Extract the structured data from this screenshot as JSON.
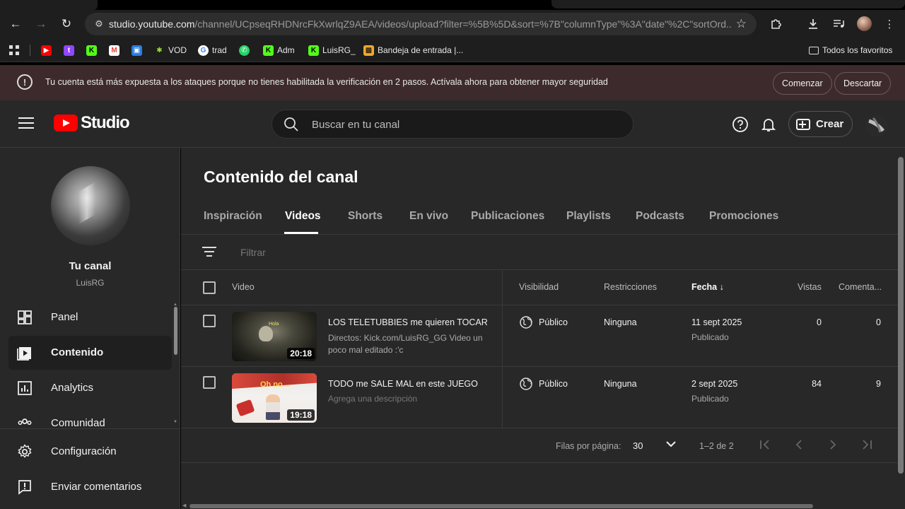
{
  "browser": {
    "url_host": "studio.youtube.com",
    "url_path": "/channel/UCpseqRHDNrcFkXwrlqZ9AEA/videos/upload?filter=%5B%5D&sort=%7B\"columnType\"%3A\"date\"%2C\"sortOrd...",
    "bookmarks": [
      "VOD",
      "trad",
      "Adm",
      "LuisRG_",
      "Bandeja de entrada |..."
    ],
    "all_bookmarks": "Todos los favoritos"
  },
  "banner": {
    "message": "Tu cuenta está más expuesta a los ataques porque no tienes habilitada la verificación en 2 pasos. Actívala ahora para obtener mayor seguridad",
    "start_label": "Comenzar",
    "dismiss_label": "Descartar"
  },
  "header": {
    "logo_text": "Studio",
    "search_placeholder": "Buscar en tu canal",
    "create_label": "Crear"
  },
  "sidebar": {
    "channel_title": "Tu canal",
    "channel_handle": "LuisRG",
    "items": [
      {
        "label": "Panel",
        "icon": "dashboard-icon"
      },
      {
        "label": "Contenido",
        "icon": "content-icon",
        "active": true
      },
      {
        "label": "Analytics",
        "icon": "analytics-icon"
      },
      {
        "label": "Comunidad",
        "icon": "community-icon"
      }
    ],
    "footer_items": [
      {
        "label": "Configuración",
        "icon": "gear-icon"
      },
      {
        "label": "Enviar comentarios",
        "icon": "feedback-icon"
      }
    ]
  },
  "main": {
    "title": "Contenido del canal",
    "tabs": [
      "Inspiración",
      "Videos",
      "Shorts",
      "En vivo",
      "Publicaciones",
      "Playlists",
      "Podcasts",
      "Promociones"
    ],
    "active_tab": "Videos",
    "filter_placeholder": "Filtrar",
    "columns": {
      "video": "Video",
      "visibility": "Visibilidad",
      "restrictions": "Restricciones",
      "date": "Fecha",
      "views": "Vistas",
      "comments": "Comenta..."
    },
    "rows": [
      {
        "title": "LOS TELETUBBIES me quieren TOCAR",
        "description": "Directos: Kick.com/LuisRG_GG Video un poco mal editado :'c",
        "duration": "20:18",
        "thumb_text": "Hola",
        "visibility": "Público",
        "restrictions": "Ninguna",
        "date": "11 sept 2025",
        "status": "Publicado",
        "views": "0",
        "comments": "0"
      },
      {
        "title": "TODO me SALE MAL en este JUEGO",
        "description": "Agrega una descripción",
        "duration": "19:18",
        "thumb_text": "Oh no...",
        "visibility": "Público",
        "restrictions": "Ninguna",
        "date": "2 sept 2025",
        "status": "Publicado",
        "views": "84",
        "comments": "9"
      }
    ],
    "pagination": {
      "rows_per_page_label": "Filas por página:",
      "rows_per_page": "30",
      "range": "1–2 de 2"
    }
  },
  "colors": {
    "bg": "#282828",
    "banner_bg": "#3d2a2c",
    "youtube_red": "#ff0000"
  }
}
